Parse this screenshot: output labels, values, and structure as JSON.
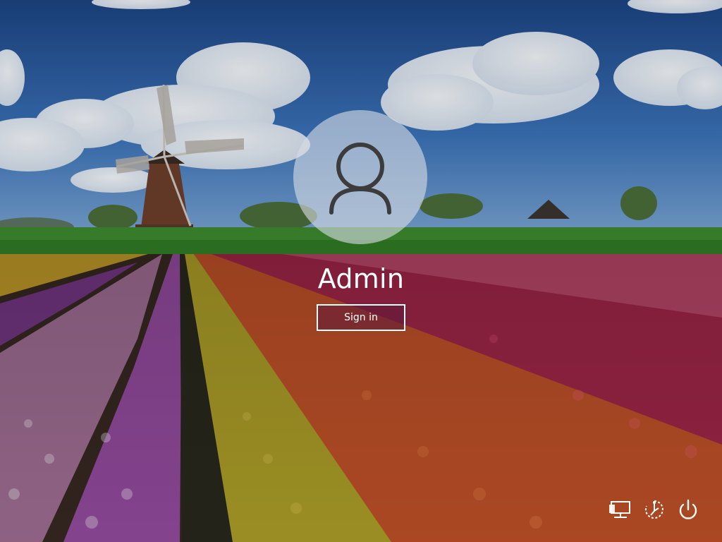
{
  "user": {
    "name": "Admin",
    "avatar_icon": "user-silhouette-icon"
  },
  "signin": {
    "label": "Sign in"
  },
  "tray": {
    "network_icon": "network-icon",
    "accessibility_icon": "ease-of-access-icon",
    "power_icon": "power-icon"
  },
  "colors": {
    "sky": "#2a5a9c",
    "signin_fill": "#5f193c",
    "text": "#ffffff"
  }
}
